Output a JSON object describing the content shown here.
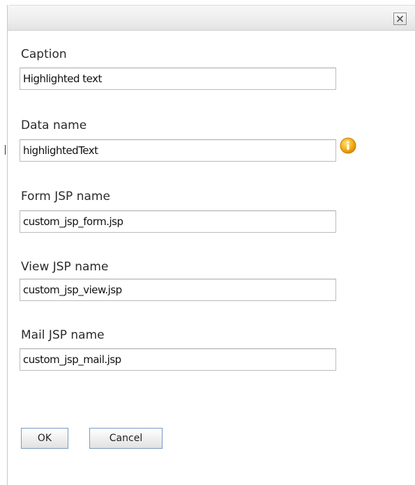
{
  "dialog": {
    "close_icon": "close-x-icon"
  },
  "fields": {
    "caption": {
      "label": "Caption",
      "value": "Highlighted text"
    },
    "data_name": {
      "label": "Data name",
      "value": "highlightedText",
      "info_icon": "info-icon"
    },
    "form_jsp": {
      "label": "Form JSP name",
      "value": "custom_jsp_form.jsp"
    },
    "view_jsp": {
      "label": "View JSP name",
      "value": "custom_jsp_view.jsp"
    },
    "mail_jsp": {
      "label": "Mail JSP name",
      "value": "custom_jsp_mail.jsp"
    }
  },
  "buttons": {
    "ok": "OK",
    "cancel": "Cancel"
  },
  "colors": {
    "info_icon": "#f0a30a",
    "button_border": "#7a9ac4"
  }
}
